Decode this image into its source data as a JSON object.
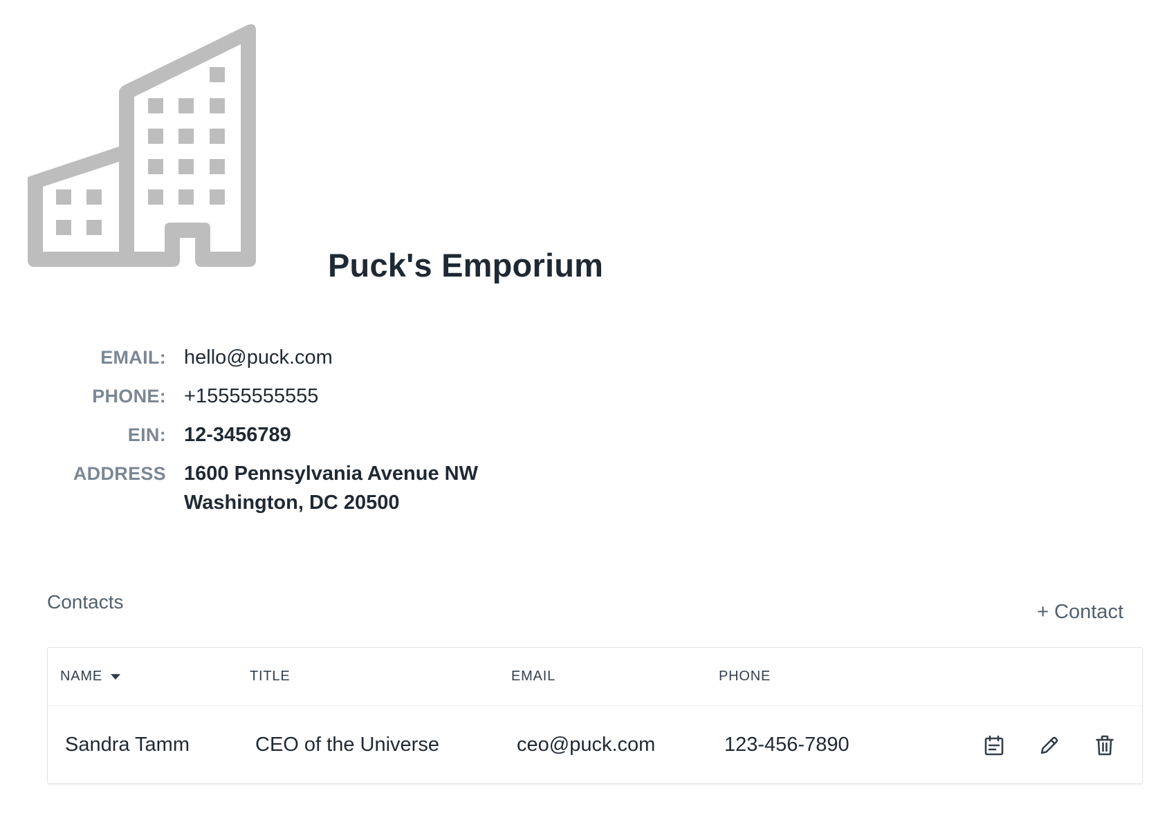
{
  "company": {
    "name": "Puck's Emporium",
    "icon": "building-icon"
  },
  "details": [
    {
      "label": "EMAIL:",
      "value": "hello@puck.com"
    },
    {
      "label": "PHONE:",
      "value": "+15555555555"
    },
    {
      "label": "EIN:",
      "value": "12-3456789"
    },
    {
      "label": "ADDRESS",
      "value_line1": "1600 Pennsylvania Avenue NW",
      "value_line2": "Washington, DC 20500"
    }
  ],
  "contacts": {
    "heading": "Contacts",
    "add_label": "+ Contact",
    "columns": [
      "NAME",
      "TITLE",
      "EMAIL",
      "PHONE"
    ],
    "sort_icon": "caret-down-icon",
    "rows": [
      {
        "name": "Sandra Tamm",
        "title": "CEO of the Universe",
        "email": "ceo@puck.com",
        "phone": "123-456-7890"
      }
    ],
    "row_actions": [
      "notes-icon",
      "pencil-icon",
      "trash-icon"
    ]
  },
  "colors": {
    "icon_gray": "#bdbdbd",
    "label_gray": "#7b8794",
    "text_dark": "#1f2933"
  }
}
